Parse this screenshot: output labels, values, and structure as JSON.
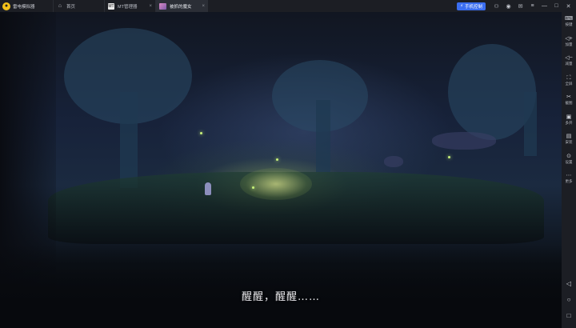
{
  "app": {
    "name": "雷电模拟器"
  },
  "tabs": [
    {
      "label": "首页",
      "icon": "home-icon"
    },
    {
      "label": "MT管理器",
      "icon": "mt-manager-icon"
    },
    {
      "label": "被抓的魔女",
      "icon": "game-thumbnail-icon"
    }
  ],
  "titlebar": {
    "promo_label": "手机控制",
    "icons": [
      "gamepad-icon",
      "user-icon",
      "mail-icon",
      "menu-icon",
      "minimize-icon",
      "restore-icon",
      "close-icon"
    ]
  },
  "game": {
    "dialog": "醒醒，醒醒……"
  },
  "sidebar": {
    "items": [
      {
        "label": "按键",
        "icon": "keyboard-icon"
      },
      {
        "label": "加量",
        "icon": "volume-up-icon"
      },
      {
        "label": "减量",
        "icon": "volume-down-icon"
      },
      {
        "label": "全屏",
        "icon": "fullscreen-icon"
      },
      {
        "label": "截图",
        "icon": "scissors-icon"
      },
      {
        "label": "多开",
        "icon": "multi-instance-icon"
      },
      {
        "label": "安装",
        "icon": "apk-install-icon"
      },
      {
        "label": "设置",
        "icon": "settings-icon"
      },
      {
        "label": "更多",
        "icon": "more-icon"
      }
    ],
    "nav": [
      "back-icon",
      "home-circle-icon",
      "recents-icon"
    ]
  }
}
